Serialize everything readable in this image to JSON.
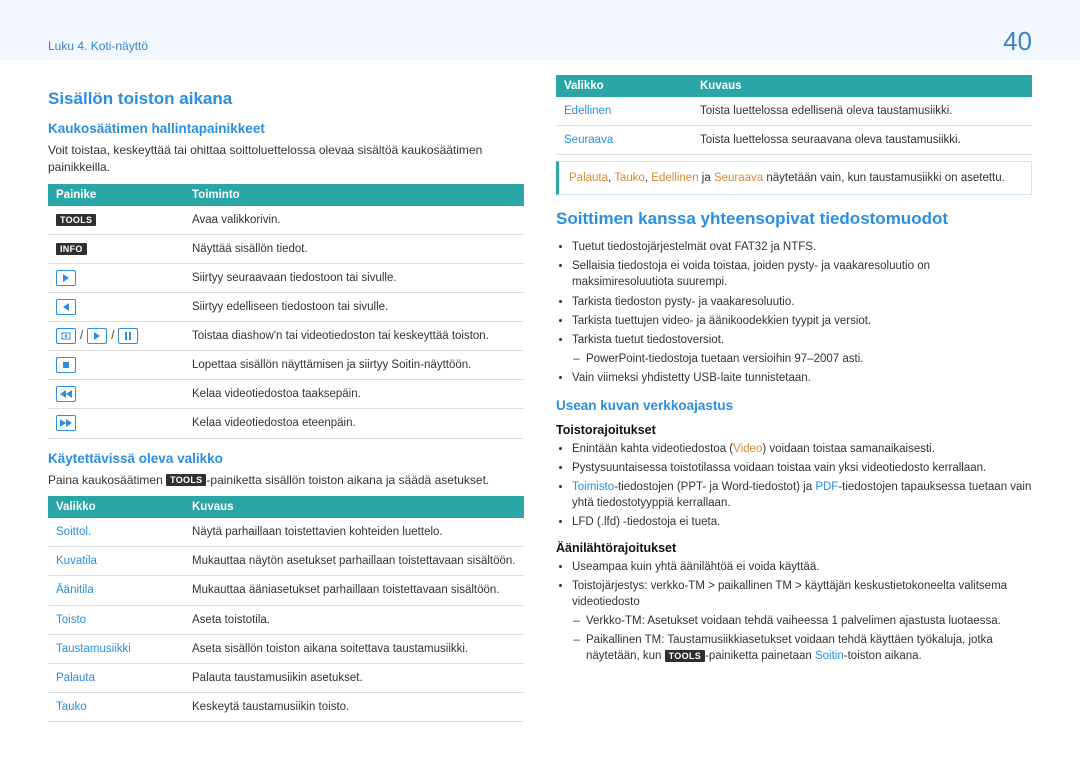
{
  "header": {
    "chapter": "Luku 4. Koti-näyttö",
    "page": "40"
  },
  "left": {
    "h2": "Sisällön toiston aikana",
    "remote": {
      "h3": "Kaukosäätimen hallintapainikkeet",
      "desc": "Voit toistaa, keskeyttää tai ohittaa soittoluettelossa olevaa sisältöä kaukosäätimen painikkeilla.",
      "th1": "Painike",
      "th2": "Toiminto",
      "rows": {
        "r0": "Avaa valikkorivin.",
        "r1": "Näyttää sisällön tiedot.",
        "r2": "Siirtyy seuraavaan tiedostoon tai sivulle.",
        "r3": "Siirtyy edelliseen tiedostoon tai sivulle.",
        "r4": "Toistaa diashow'n tai videotiedoston tai keskeyttää toiston.",
        "r5": "Lopettaa sisällön näyttämisen ja siirtyy Soitin-näyttöön.",
        "r6": "Kelaa videotiedostoa taaksepäin.",
        "r7": "Kelaa videotiedostoa eteenpäin."
      },
      "badges": {
        "tools": "TOOLS",
        "info": "INFO"
      }
    },
    "menu": {
      "h3": "Käytettävissä oleva valikko",
      "desc_pre": "Paina kaukosäätimen ",
      "desc_post": "-painiketta sisällön toiston aikana ja säädä asetukset.",
      "th1": "Valikko",
      "th2": "Kuvaus",
      "rows": [
        {
          "name": "Soittol.",
          "desc": "Näytä parhaillaan toistettavien kohteiden luettelo."
        },
        {
          "name": "Kuvatila",
          "desc": "Mukauttaa näytön asetukset parhaillaan toistettavaan sisältöön."
        },
        {
          "name": "Äänitila",
          "desc": "Mukauttaa ääniasetukset parhaillaan toistettavaan sisältöön."
        },
        {
          "name": "Toisto",
          "desc": "Aseta toistotila."
        },
        {
          "name": "Taustamusiikki",
          "desc": "Aseta sisällön toiston aikana soitettava taustamusiikki."
        },
        {
          "name": "Palauta",
          "desc": "Palauta taustamusiikin asetukset."
        },
        {
          "name": "Tauko",
          "desc": "Keskeytä taustamusiikin toisto."
        }
      ]
    }
  },
  "right": {
    "menu_cont": {
      "th1": "Valikko",
      "th2": "Kuvaus",
      "rows": [
        {
          "name": "Edellinen",
          "desc": "Toista luettelossa edellisenä oleva taustamusiikki."
        },
        {
          "name": "Seuraava",
          "desc": "Toista luettelossa seuraavana oleva taustamusiikki."
        }
      ]
    },
    "note": {
      "a": "Palauta",
      "b": "Tauko",
      "c": "Edellinen",
      "ja": " ja ",
      "d": "Seuraava",
      "tail": " näytetään vain, kun taustamusiikki on asetettu."
    },
    "compat": {
      "h2": "Soittimen kanssa yhteensopivat tiedostomuodot",
      "bullets": [
        "Tuetut tiedostojärjestelmät ovat FAT32 ja NTFS.",
        "Sellaisia tiedostoja ei voida toistaa, joiden pysty- ja vaakaresoluutio on maksimiresoluutiota suurempi.",
        "Tarkista tiedoston pysty- ja vaakaresoluutio.",
        "Tarkista tuettujen video- ja äänikoodekkien tyypit ja versiot.",
        "Tarkista tuetut tiedostoversiot."
      ],
      "sub_ppt": "PowerPoint-tiedostoja tuetaan versioihin 97–2007 asti.",
      "last": "Vain viimeksi yhdistetty USB-laite tunnistetaan."
    },
    "network": {
      "h3": "Usean kuvan verkkoajastus",
      "playback_h": "Toistorajoitukset",
      "pb_b1_pre": "Enintään kahta videotiedostoa (",
      "pb_b1_link": "Video",
      "pb_b1_post": ") voidaan toistaa samanaikaisesti.",
      "pb_b2": "Pystysuuntaisessa toistotilassa voidaan toistaa vain yksi videotiedosto kerrallaan.",
      "pb_b3_a": "Toimisto",
      "pb_b3_mid": "-tiedostojen (PPT- ja Word-tiedostot) ja ",
      "pb_b3_b": "PDF",
      "pb_b3_post": "-tiedostojen tapauksessa tuetaan vain yhtä tiedostotyyppiä kerrallaan.",
      "pb_b4": "LFD (.lfd) -tiedostoja ei tueta.",
      "audio_h": "Äänilähtörajoitukset",
      "au_b1": "Useampaa kuin yhtä äänilähtöä ei voida käyttää.",
      "au_b2": "Toistojärjestys: verkko-TM > paikallinen TM > käyttäjän keskustietokoneelta valitsema videotiedosto",
      "au_sub1": "Verkko-TM: Asetukset voidaan tehdä vaiheessa 1 palvelimen ajastusta luotaessa.",
      "au_sub2_pre": "Paikallinen TM: Taustamusiikkiasetukset voidaan tehdä käyttäen työkaluja, jotka näytetään, kun ",
      "au_sub2_post": "-painiketta painetaan ",
      "au_sub2_link": "Soitin",
      "au_sub2_tail": "-toiston aikana."
    }
  }
}
